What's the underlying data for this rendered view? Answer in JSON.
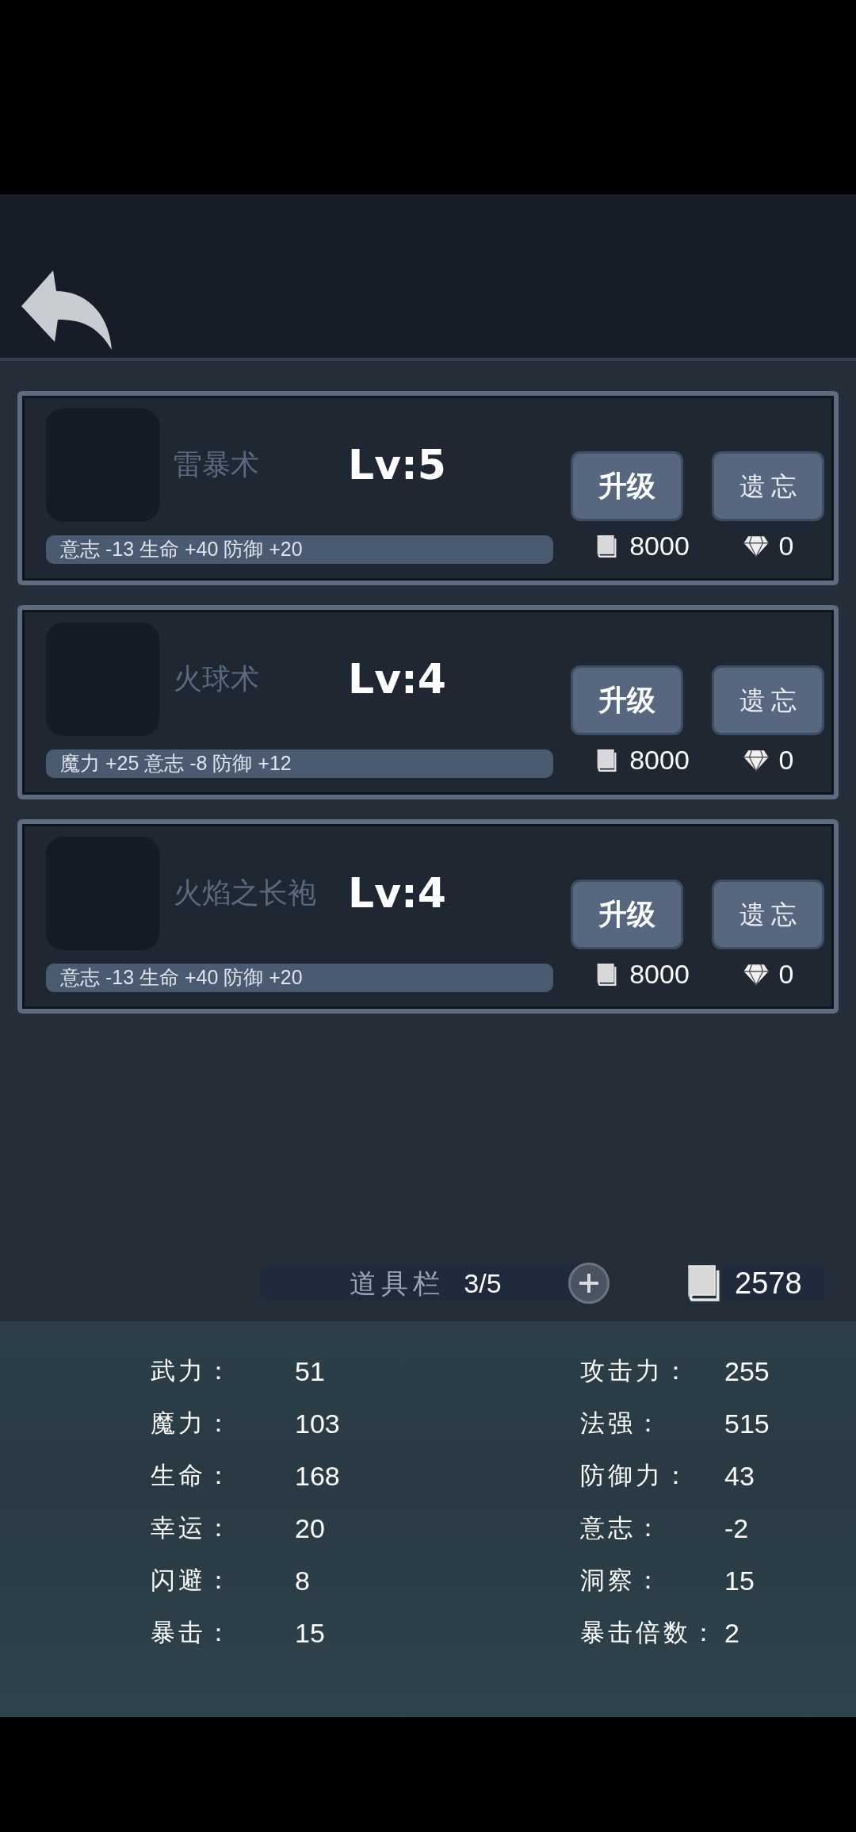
{
  "skills": [
    {
      "name": "雷暴术",
      "level_text": "Lv:5",
      "effects": "意志 -13 生命 +40 防御 +20",
      "upgrade_label": "升级",
      "forget_label": "遗 忘",
      "upgrade_cost": "8000",
      "forget_cost": "0"
    },
    {
      "name": "火球术",
      "level_text": "Lv:4",
      "effects": "魔力 +25 意志 -8 防御 +12",
      "upgrade_label": "升级",
      "forget_label": "遗 忘",
      "upgrade_cost": "8000",
      "forget_cost": "0"
    },
    {
      "name": "火焰之长袍",
      "level_text": "Lv:4",
      "effects": "意志 -13 生命 +40 防御 +20",
      "upgrade_label": "升级",
      "forget_label": "遗 忘",
      "upgrade_cost": "8000",
      "forget_cost": "0"
    }
  ],
  "item_bar": {
    "label": "道具栏",
    "count": "3/5"
  },
  "books": "2578",
  "stats": [
    {
      "label": "武力：",
      "value": "51"
    },
    {
      "label": "攻击力：",
      "value": "255"
    },
    {
      "label": "魔力：",
      "value": "103"
    },
    {
      "label": "法强：",
      "value": "515"
    },
    {
      "label": "生命：",
      "value": "168"
    },
    {
      "label": "防御力：",
      "value": "43"
    },
    {
      "label": "幸运：",
      "value": "20"
    },
    {
      "label": "意志：",
      "value": "-2"
    },
    {
      "label": "闪避：",
      "value": "8"
    },
    {
      "label": "洞察：",
      "value": "15"
    },
    {
      "label": "暴击：",
      "value": "15"
    },
    {
      "label": "暴击倍数：",
      "value": "2"
    }
  ]
}
